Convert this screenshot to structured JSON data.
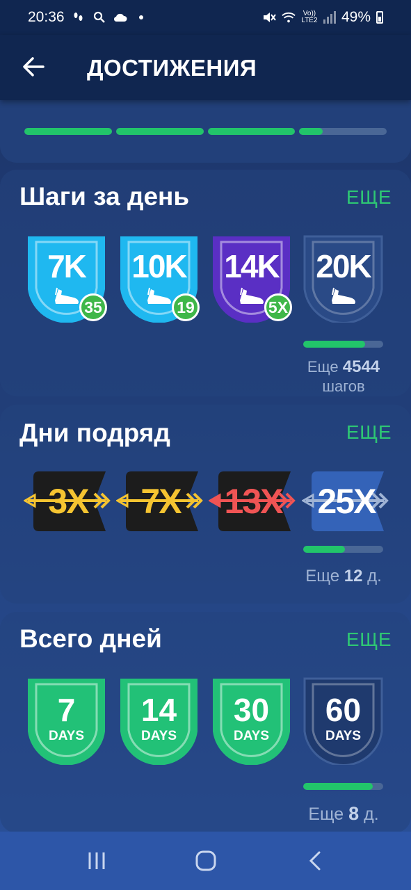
{
  "status_bar": {
    "time": "20:36",
    "battery": "49%",
    "network": "Vo)) LTE2"
  },
  "header": {
    "title": "ДОСТИЖЕНИЯ"
  },
  "top_card": {
    "segments_fill": [
      1,
      1,
      1,
      0.27
    ]
  },
  "steps": {
    "title": "Шаги за день",
    "more": "ЕЩЕ",
    "badges": [
      {
        "label": "7K",
        "count": "35",
        "color": "#1fb8f0",
        "earned": true
      },
      {
        "label": "10K",
        "count": "19",
        "color": "#1fb8f0",
        "earned": true
      },
      {
        "label": "14K",
        "count": "5X",
        "color": "#5a2fc4",
        "earned": true
      },
      {
        "label": "20K",
        "count": "",
        "color": "#2a4a86",
        "earned": false
      }
    ],
    "progress": 0.77,
    "remain_prefix": "Еще",
    "remain_value": "4544",
    "remain_suffix": "шагов"
  },
  "streak": {
    "title": "Дни подряд",
    "more": "ЕЩЕ",
    "badges": [
      {
        "label": "3X",
        "text_color": "#f5c431",
        "arrow_color": "#f5c431",
        "earned": true
      },
      {
        "label": "7X",
        "text_color": "#f5c431",
        "arrow_color": "#f5c431",
        "earned": true
      },
      {
        "label": "13X",
        "text_color": "#f05454",
        "arrow_color": "#f05454",
        "earned": true
      },
      {
        "label": "25X",
        "text_color": "#ffffff",
        "arrow_color": "#9fb3d4",
        "earned": false
      }
    ],
    "progress": 0.52,
    "remain_prefix": "Еще",
    "remain_value": "12",
    "remain_suffix": "д."
  },
  "total": {
    "title": "Всего дней",
    "more": "ЕЩЕ",
    "badges": [
      {
        "number": "7",
        "unit": "DAYS",
        "color": "#22c177",
        "earned": true
      },
      {
        "number": "14",
        "unit": "DAYS",
        "color": "#22c177",
        "earned": true
      },
      {
        "number": "30",
        "unit": "DAYS",
        "color": "#22c177",
        "earned": true
      },
      {
        "number": "60",
        "unit": "DAYS",
        "color": "#2a4a86",
        "earned": false
      }
    ],
    "progress": 0.87,
    "remain_prefix": "Еще",
    "remain_value": "8",
    "remain_suffix": "д."
  },
  "colors": {
    "accent_green": "#2ec774",
    "bg": "#1c3468",
    "header": "#102650"
  }
}
